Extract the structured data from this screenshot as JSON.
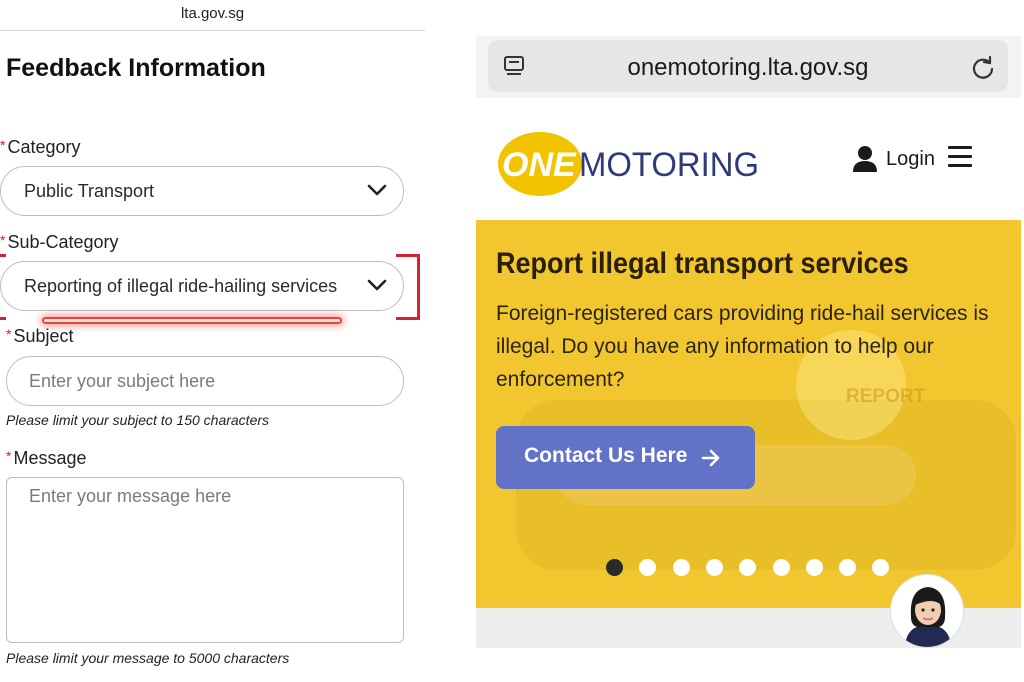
{
  "left_panel": {
    "domain": "lta.gov.sg",
    "form_title": "Feedback Information",
    "required_mark": "*",
    "category": {
      "label": "Category",
      "value": "Public Transport"
    },
    "sub_category": {
      "label": "Sub-Category",
      "value": "Reporting of illegal ride-hailing services"
    },
    "subject": {
      "label": "Subject",
      "placeholder": "Enter your subject here",
      "hint": "Please limit your subject to 150 characters"
    },
    "message": {
      "label": "Message",
      "placeholder": "Enter your message here",
      "hint": "Please limit your message to 5000 characters"
    },
    "highlight_color": "#d4242b"
  },
  "right_panel": {
    "url": "onemotoring.lta.gov.sg",
    "logo": {
      "part1": "ONE",
      "part2": "MOTORING",
      "yellow": "#f2c400",
      "navy": "#2f3a7a"
    },
    "login_label": "Login",
    "hero": {
      "title": "Report illegal transport services",
      "body": "Foreign-registered cars providing ride-hail services is illegal. Do you have any information to help our enforcement?",
      "background_text": "REPORT",
      "cta_label": "Contact Us Here",
      "background_color": "#f2c62e",
      "cta_color": "#6272c7"
    },
    "carousel": {
      "total_slides": 9,
      "active_index": 0
    }
  }
}
